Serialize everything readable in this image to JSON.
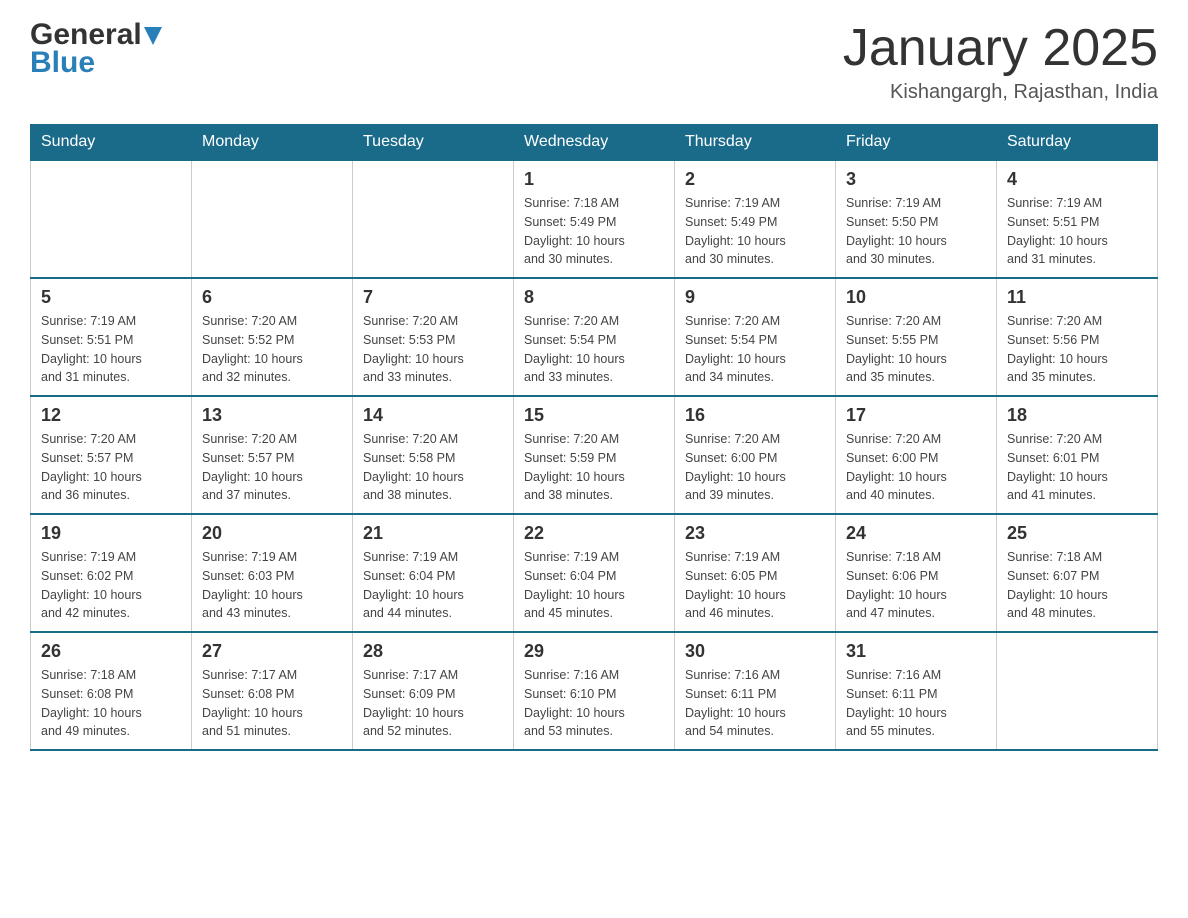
{
  "header": {
    "logo": {
      "general": "General",
      "blue": "Blue",
      "triangle_color": "#2980b9"
    },
    "title": "January 2025",
    "location": "Kishangargh, Rajasthan, India"
  },
  "calendar": {
    "header_color": "#1a6b8a",
    "days": [
      "Sunday",
      "Monday",
      "Tuesday",
      "Wednesday",
      "Thursday",
      "Friday",
      "Saturday"
    ],
    "weeks": [
      {
        "cells": [
          {
            "day": "",
            "info": ""
          },
          {
            "day": "",
            "info": ""
          },
          {
            "day": "",
            "info": ""
          },
          {
            "day": "1",
            "info": "Sunrise: 7:18 AM\nSunset: 5:49 PM\nDaylight: 10 hours\nand 30 minutes."
          },
          {
            "day": "2",
            "info": "Sunrise: 7:19 AM\nSunset: 5:49 PM\nDaylight: 10 hours\nand 30 minutes."
          },
          {
            "day": "3",
            "info": "Sunrise: 7:19 AM\nSunset: 5:50 PM\nDaylight: 10 hours\nand 30 minutes."
          },
          {
            "day": "4",
            "info": "Sunrise: 7:19 AM\nSunset: 5:51 PM\nDaylight: 10 hours\nand 31 minutes."
          }
        ]
      },
      {
        "cells": [
          {
            "day": "5",
            "info": "Sunrise: 7:19 AM\nSunset: 5:51 PM\nDaylight: 10 hours\nand 31 minutes."
          },
          {
            "day": "6",
            "info": "Sunrise: 7:20 AM\nSunset: 5:52 PM\nDaylight: 10 hours\nand 32 minutes."
          },
          {
            "day": "7",
            "info": "Sunrise: 7:20 AM\nSunset: 5:53 PM\nDaylight: 10 hours\nand 33 minutes."
          },
          {
            "day": "8",
            "info": "Sunrise: 7:20 AM\nSunset: 5:54 PM\nDaylight: 10 hours\nand 33 minutes."
          },
          {
            "day": "9",
            "info": "Sunrise: 7:20 AM\nSunset: 5:54 PM\nDaylight: 10 hours\nand 34 minutes."
          },
          {
            "day": "10",
            "info": "Sunrise: 7:20 AM\nSunset: 5:55 PM\nDaylight: 10 hours\nand 35 minutes."
          },
          {
            "day": "11",
            "info": "Sunrise: 7:20 AM\nSunset: 5:56 PM\nDaylight: 10 hours\nand 35 minutes."
          }
        ]
      },
      {
        "cells": [
          {
            "day": "12",
            "info": "Sunrise: 7:20 AM\nSunset: 5:57 PM\nDaylight: 10 hours\nand 36 minutes."
          },
          {
            "day": "13",
            "info": "Sunrise: 7:20 AM\nSunset: 5:57 PM\nDaylight: 10 hours\nand 37 minutes."
          },
          {
            "day": "14",
            "info": "Sunrise: 7:20 AM\nSunset: 5:58 PM\nDaylight: 10 hours\nand 38 minutes."
          },
          {
            "day": "15",
            "info": "Sunrise: 7:20 AM\nSunset: 5:59 PM\nDaylight: 10 hours\nand 38 minutes."
          },
          {
            "day": "16",
            "info": "Sunrise: 7:20 AM\nSunset: 6:00 PM\nDaylight: 10 hours\nand 39 minutes."
          },
          {
            "day": "17",
            "info": "Sunrise: 7:20 AM\nSunset: 6:00 PM\nDaylight: 10 hours\nand 40 minutes."
          },
          {
            "day": "18",
            "info": "Sunrise: 7:20 AM\nSunset: 6:01 PM\nDaylight: 10 hours\nand 41 minutes."
          }
        ]
      },
      {
        "cells": [
          {
            "day": "19",
            "info": "Sunrise: 7:19 AM\nSunset: 6:02 PM\nDaylight: 10 hours\nand 42 minutes."
          },
          {
            "day": "20",
            "info": "Sunrise: 7:19 AM\nSunset: 6:03 PM\nDaylight: 10 hours\nand 43 minutes."
          },
          {
            "day": "21",
            "info": "Sunrise: 7:19 AM\nSunset: 6:04 PM\nDaylight: 10 hours\nand 44 minutes."
          },
          {
            "day": "22",
            "info": "Sunrise: 7:19 AM\nSunset: 6:04 PM\nDaylight: 10 hours\nand 45 minutes."
          },
          {
            "day": "23",
            "info": "Sunrise: 7:19 AM\nSunset: 6:05 PM\nDaylight: 10 hours\nand 46 minutes."
          },
          {
            "day": "24",
            "info": "Sunrise: 7:18 AM\nSunset: 6:06 PM\nDaylight: 10 hours\nand 47 minutes."
          },
          {
            "day": "25",
            "info": "Sunrise: 7:18 AM\nSunset: 6:07 PM\nDaylight: 10 hours\nand 48 minutes."
          }
        ]
      },
      {
        "cells": [
          {
            "day": "26",
            "info": "Sunrise: 7:18 AM\nSunset: 6:08 PM\nDaylight: 10 hours\nand 49 minutes."
          },
          {
            "day": "27",
            "info": "Sunrise: 7:17 AM\nSunset: 6:08 PM\nDaylight: 10 hours\nand 51 minutes."
          },
          {
            "day": "28",
            "info": "Sunrise: 7:17 AM\nSunset: 6:09 PM\nDaylight: 10 hours\nand 52 minutes."
          },
          {
            "day": "29",
            "info": "Sunrise: 7:16 AM\nSunset: 6:10 PM\nDaylight: 10 hours\nand 53 minutes."
          },
          {
            "day": "30",
            "info": "Sunrise: 7:16 AM\nSunset: 6:11 PM\nDaylight: 10 hours\nand 54 minutes."
          },
          {
            "day": "31",
            "info": "Sunrise: 7:16 AM\nSunset: 6:11 PM\nDaylight: 10 hours\nand 55 minutes."
          },
          {
            "day": "",
            "info": ""
          }
        ]
      }
    ]
  }
}
